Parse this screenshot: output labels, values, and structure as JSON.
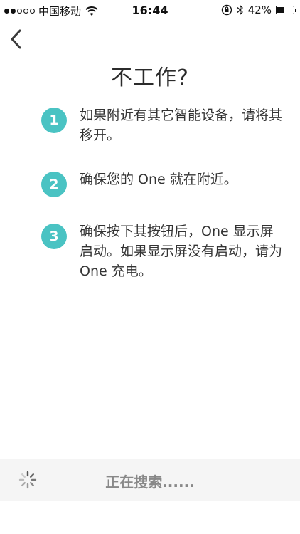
{
  "status_bar": {
    "carrier": "中国移动",
    "time": "16:44",
    "battery_percent": "42%",
    "battery_level": 0.42,
    "signal_bars_filled": 2,
    "signal_bars_total": 5
  },
  "header": {
    "back_icon": "chevron-left-icon"
  },
  "main": {
    "title": "不工作?",
    "accent_color": "#4ac3c3",
    "steps": [
      {
        "number": "1",
        "text": "如果附近有其它智能设备，请将其移开。"
      },
      {
        "number": "2",
        "text": "确保您的 One 就在附近。"
      },
      {
        "number": "3",
        "text": "确保按下其按钮后，One 显示屏启动。如果显示屏没有启动，请为 One 充电。"
      }
    ]
  },
  "footer": {
    "status_text": "正在搜索......",
    "spinner_icon": "loading-spinner-icon"
  }
}
